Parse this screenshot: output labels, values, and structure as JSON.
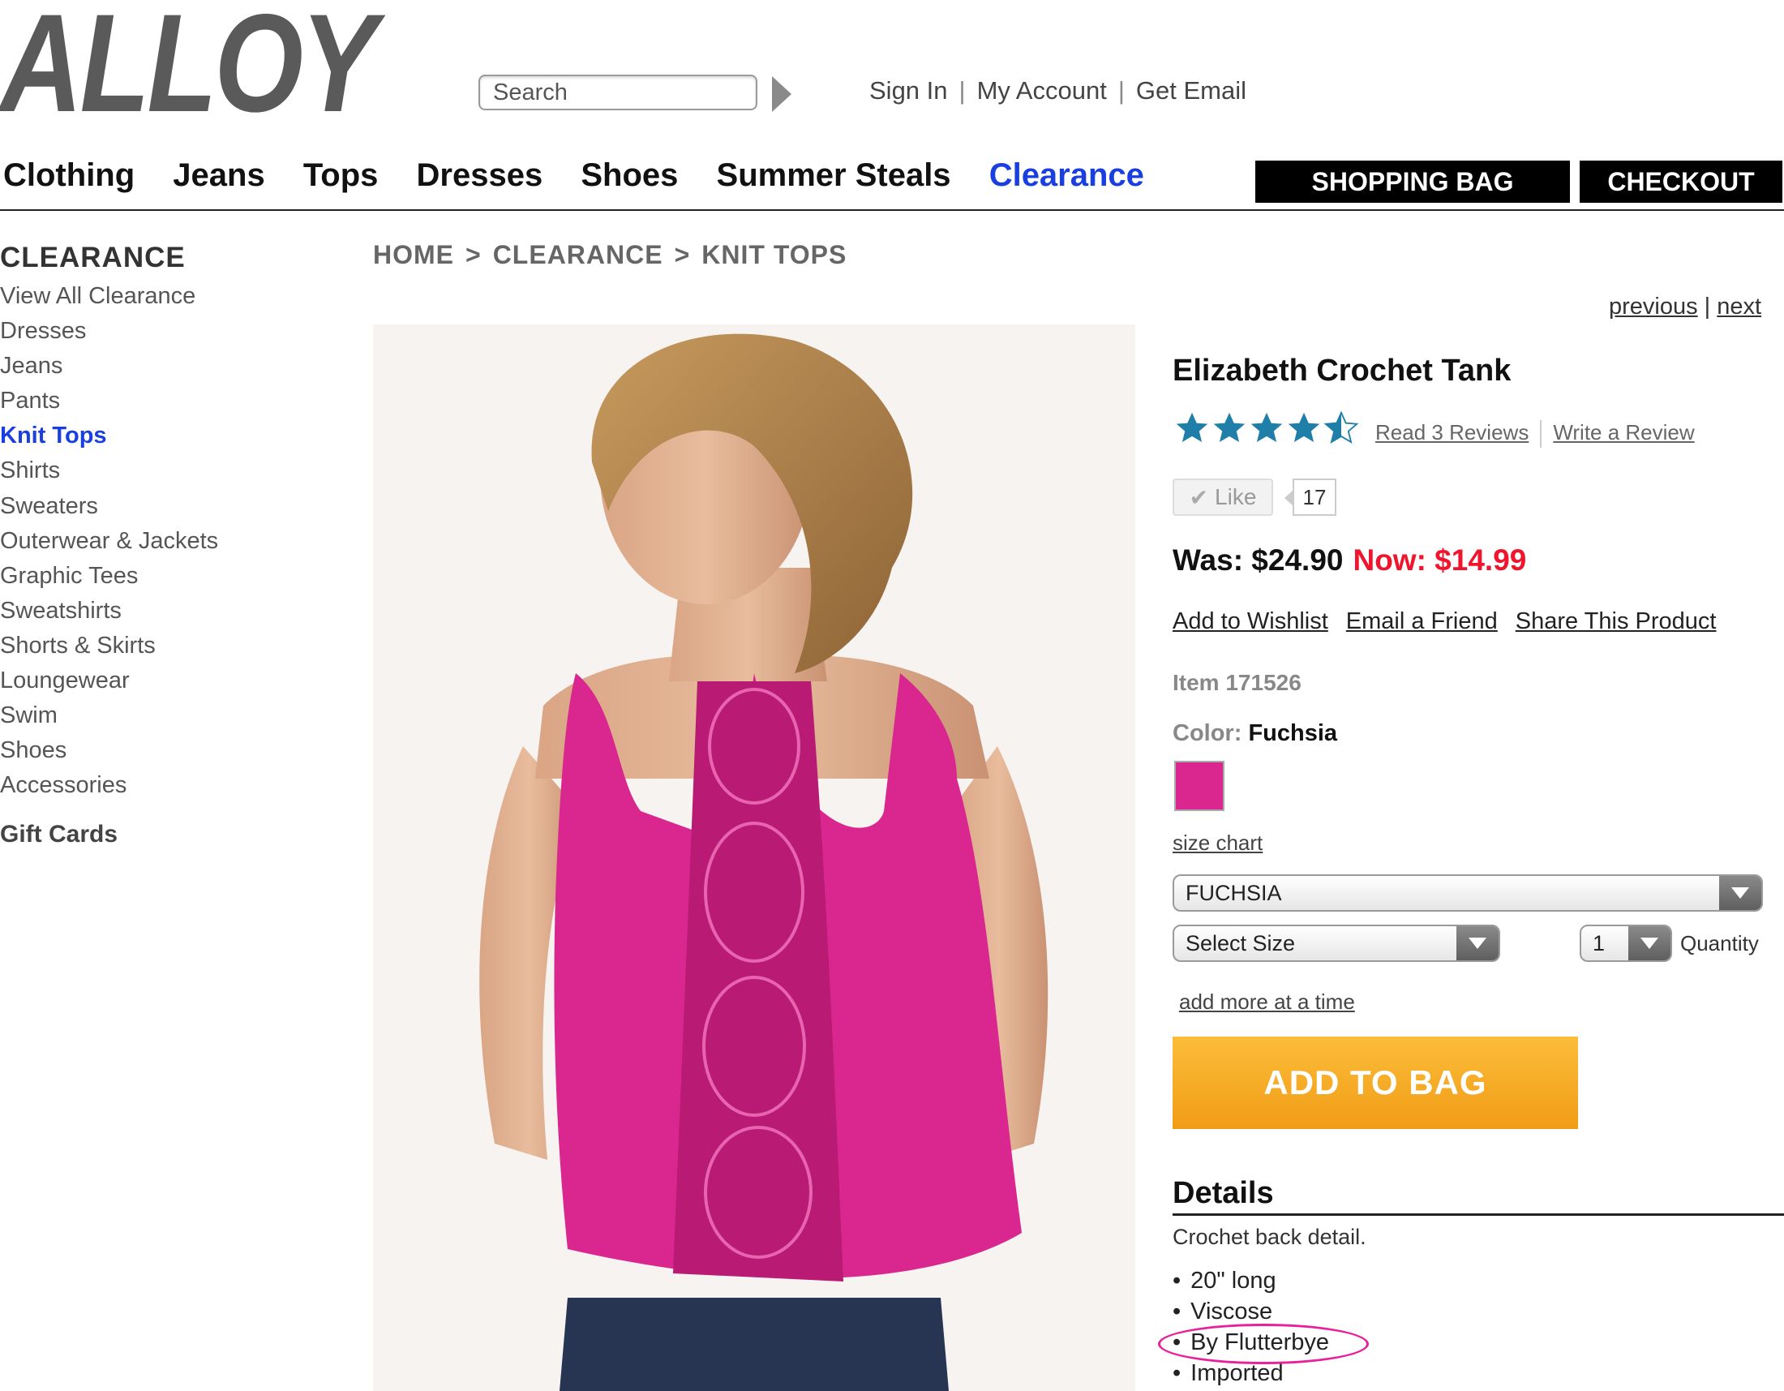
{
  "header": {
    "logo": "ALLOY",
    "search": {
      "placeholder": "Search"
    },
    "account_links": [
      "Sign In",
      "My Account",
      "Get Email"
    ]
  },
  "main_nav": {
    "items": [
      "Clothing",
      "Jeans",
      "Tops",
      "Dresses",
      "Shoes",
      "Summer Steals",
      "Clearance"
    ],
    "active": "Clearance",
    "shopping_bag": "SHOPPING BAG",
    "checkout": "CHECKOUT"
  },
  "sidebar": {
    "title": "CLEARANCE",
    "items": [
      "View All Clearance",
      "Dresses",
      "Jeans",
      "Pants",
      "Knit Tops",
      "Shirts",
      "Sweaters",
      "Outerwear & Jackets",
      "Graphic Tees",
      "Sweatshirts",
      "Shorts & Skirts",
      "Loungewear",
      "Swim",
      "Shoes",
      "Accessories"
    ],
    "active": "Knit Tops",
    "gift_cards": "Gift Cards"
  },
  "breadcrumb": [
    "HOME",
    "CLEARANCE",
    "KNIT TOPS"
  ],
  "pager": {
    "previous": "previous",
    "next": "next"
  },
  "product": {
    "title": "Elizabeth Crochet Tank",
    "rating": 4.5,
    "rating_max": 5,
    "read_reviews": "Read 3 Reviews",
    "write_review": "Write a Review",
    "like_label": "Like",
    "like_count": "17",
    "was_price": "Was: $24.90",
    "now_price": "Now: $14.99",
    "actions": [
      "Add to Wishlist",
      "Email a Friend",
      "Share This Product"
    ],
    "item_number": "Item 171526",
    "color_label": "Color:",
    "color_value": "Fuchsia",
    "swatch_color": "#d9278f",
    "size_chart": "size chart",
    "color_select": "FUCHSIA",
    "size_select": "Select Size",
    "quantity_value": "1",
    "quantity_label": "Quantity",
    "add_more": "add more at a time",
    "add_to_bag": "ADD TO BAG",
    "details_title": "Details",
    "details_desc": "Crochet back detail.",
    "details_list": [
      "20\" long",
      "Viscose",
      "By Flutterbye",
      "Imported"
    ]
  },
  "colors": {
    "accent_blue": "#1a3fe0",
    "sale_red": "#f0142c",
    "star_blue": "#1f7fa8",
    "button_orange": "#f5a623",
    "highlight_pink": "#e8209b"
  },
  "icons": {
    "like": "checkmark-icon",
    "dropdown": "chevron-down-icon",
    "search_submit": "arrow-right-icon",
    "rating": "star-icon"
  }
}
